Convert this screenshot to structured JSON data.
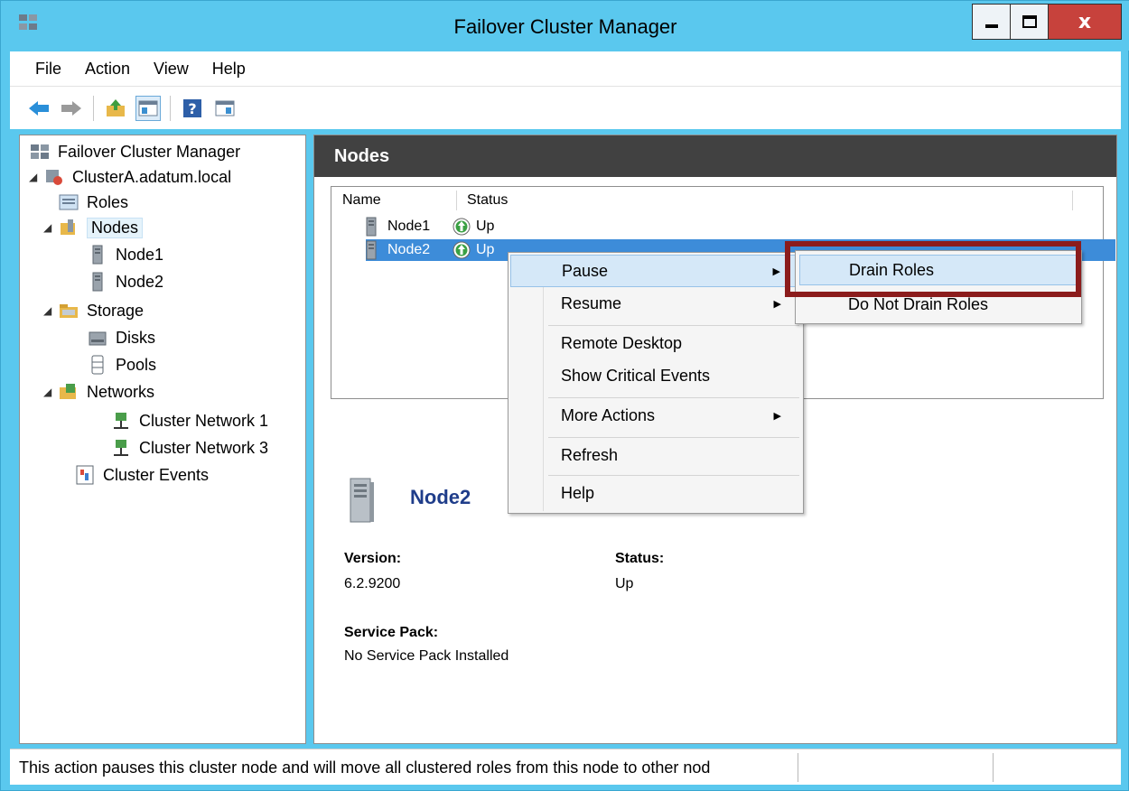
{
  "window": {
    "title": "Failover Cluster Manager",
    "close_glyph": "x"
  },
  "menubar": [
    "File",
    "Action",
    "View",
    "Help"
  ],
  "tree": {
    "root": "Failover Cluster Manager",
    "cluster": "ClusterA.adatum.local",
    "roles": "Roles",
    "nodes": "Nodes",
    "node1": "Node1",
    "node2": "Node2",
    "storage": "Storage",
    "disks": "Disks",
    "pools": "Pools",
    "networks": "Networks",
    "network1": "Cluster Network 1",
    "network3": "Cluster Network 3",
    "events": "Cluster Events"
  },
  "main": {
    "header": "Nodes",
    "columns": [
      "Name",
      "Status"
    ],
    "rows": [
      {
        "name": "Node1",
        "status": "Up"
      },
      {
        "name": "Node2",
        "status": "Up"
      }
    ]
  },
  "details": {
    "name": "Node2",
    "version_label": "Version:",
    "version_value": "6.2.9200",
    "status_label": "Status:",
    "status_value": "Up",
    "sp_label": "Service Pack:",
    "sp_value": "No Service Pack Installed"
  },
  "context_menu": {
    "items": [
      "Pause",
      "Resume",
      "Remote Desktop",
      "Show Critical Events",
      "More Actions",
      "Refresh",
      "Help"
    ]
  },
  "submenu": {
    "items": [
      "Drain Roles",
      "Do Not Drain Roles"
    ]
  },
  "statusbar": {
    "text": "This action pauses this cluster node and will move all clustered roles from this node to other nod"
  },
  "colors": {
    "titlebar": "#5ac8ee",
    "selection": "#3d8cd9",
    "highlight_box": "#8b1c1c",
    "header_bar": "#414141"
  }
}
